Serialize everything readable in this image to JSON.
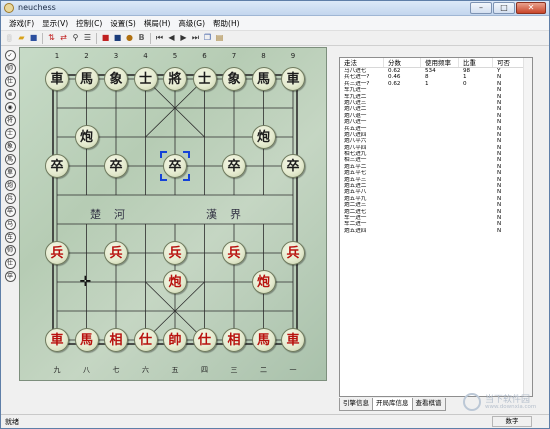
{
  "window": {
    "title": "neuchess"
  },
  "menu": [
    "游戏(F)",
    "显示(V)",
    "控制(C)",
    "设置(S)",
    "棋局(H)",
    "高级(G)",
    "帮助(H)"
  ],
  "toolbar": {
    "icons": [
      "new-icon",
      "open-icon",
      "save-icon",
      "flip-board-icon",
      "swap-icon",
      "tree-icon",
      "list-icon",
      "red-stop-icon",
      "computer-icon",
      "bold-icon",
      "first-move-icon",
      "prev-move-icon",
      "next-move-icon",
      "last-move-icon",
      "copy-icon",
      "paste-icon"
    ]
  },
  "left_tools": [
    "✓",
    "帅",
    "仕",
    "⊗",
    "◉",
    "将",
    "士",
    "象",
    "馬",
    "車",
    "炮",
    "兵",
    "卒",
    "马",
    "车",
    "帅",
    "仕",
    "卒"
  ],
  "board": {
    "top_files": [
      "1",
      "2",
      "3",
      "4",
      "5",
      "6",
      "7",
      "8",
      "9"
    ],
    "bottom_files": [
      "九",
      "八",
      "七",
      "六",
      "五",
      "四",
      "三",
      "二",
      "一"
    ],
    "river_left": "楚　河",
    "river_right": "漢　界",
    "pieces": [
      {
        "ch": "車",
        "side": "black",
        "col": 0,
        "row": 0
      },
      {
        "ch": "馬",
        "side": "black",
        "col": 1,
        "row": 0
      },
      {
        "ch": "象",
        "side": "black",
        "col": 2,
        "row": 0
      },
      {
        "ch": "士",
        "side": "black",
        "col": 3,
        "row": 0
      },
      {
        "ch": "將",
        "side": "black",
        "col": 4,
        "row": 0
      },
      {
        "ch": "士",
        "side": "black",
        "col": 5,
        "row": 0
      },
      {
        "ch": "象",
        "side": "black",
        "col": 6,
        "row": 0
      },
      {
        "ch": "馬",
        "side": "black",
        "col": 7,
        "row": 0
      },
      {
        "ch": "車",
        "side": "black",
        "col": 8,
        "row": 0
      },
      {
        "ch": "炮",
        "side": "black",
        "col": 1,
        "row": 2
      },
      {
        "ch": "炮",
        "side": "black",
        "col": 7,
        "row": 2
      },
      {
        "ch": "卒",
        "side": "black",
        "col": 0,
        "row": 3
      },
      {
        "ch": "卒",
        "side": "black",
        "col": 2,
        "row": 3
      },
      {
        "ch": "卒",
        "side": "black",
        "col": 4,
        "row": 3
      },
      {
        "ch": "卒",
        "side": "black",
        "col": 6,
        "row": 3
      },
      {
        "ch": "卒",
        "side": "black",
        "col": 8,
        "row": 3
      },
      {
        "ch": "兵",
        "side": "red",
        "col": 0,
        "row": 6
      },
      {
        "ch": "兵",
        "side": "red",
        "col": 2,
        "row": 6
      },
      {
        "ch": "兵",
        "side": "red",
        "col": 4,
        "row": 6
      },
      {
        "ch": "兵",
        "side": "red",
        "col": 6,
        "row": 6
      },
      {
        "ch": "兵",
        "side": "red",
        "col": 8,
        "row": 6
      },
      {
        "ch": "炮",
        "side": "red",
        "col": 4,
        "row": 7
      },
      {
        "ch": "炮",
        "side": "red",
        "col": 7,
        "row": 7
      },
      {
        "ch": "車",
        "side": "red",
        "col": 0,
        "row": 9
      },
      {
        "ch": "馬",
        "side": "red",
        "col": 1,
        "row": 9
      },
      {
        "ch": "相",
        "side": "red",
        "col": 2,
        "row": 9
      },
      {
        "ch": "仕",
        "side": "red",
        "col": 3,
        "row": 9
      },
      {
        "ch": "帥",
        "side": "red",
        "col": 4,
        "row": 9
      },
      {
        "ch": "仕",
        "side": "red",
        "col": 5,
        "row": 9
      },
      {
        "ch": "相",
        "side": "red",
        "col": 6,
        "row": 9
      },
      {
        "ch": "馬",
        "side": "red",
        "col": 7,
        "row": 9
      },
      {
        "ch": "車",
        "side": "red",
        "col": 8,
        "row": 9
      }
    ],
    "selected": {
      "col": 4,
      "row": 3
    },
    "cursor": {
      "col": 1,
      "row": 7
    }
  },
  "book": {
    "headers": [
      "走法",
      "分数",
      "使用频率",
      "比重",
      "可否"
    ],
    "rows": [
      [
        "马八进七",
        "0.62",
        "534",
        "98",
        "Y"
      ],
      [
        "兵七进一?",
        "0.46",
        "8",
        "1",
        "N"
      ],
      [
        "兵三进一?",
        "0.62",
        "1",
        "0",
        "N"
      ],
      [
        "车九进一",
        "",
        "",
        "",
        "N"
      ],
      [
        "车九进二",
        "",
        "",
        "",
        "N"
      ],
      [
        "炮八进三",
        "",
        "",
        "",
        "N"
      ],
      [
        "炮八进二",
        "",
        "",
        "",
        "N"
      ],
      [
        "炮八退一",
        "",
        "",
        "",
        "N"
      ],
      [
        "炮八进一",
        "",
        "",
        "",
        "N"
      ],
      [
        "兵五进一",
        "",
        "",
        "",
        "N"
      ],
      [
        "炮八进四",
        "",
        "",
        "",
        "N"
      ],
      [
        "炮八平六",
        "",
        "",
        "",
        "N"
      ],
      [
        "炮八平四",
        "",
        "",
        "",
        "N"
      ],
      [
        "相七进九",
        "",
        "",
        "",
        "N"
      ],
      [
        "相三进一",
        "",
        "",
        "",
        "N"
      ],
      [
        "炮五平二",
        "",
        "",
        "",
        "N"
      ],
      [
        "炮五平七",
        "",
        "",
        "",
        "N"
      ],
      [
        "炮五平三",
        "",
        "",
        "",
        "N"
      ],
      [
        "炮五进二",
        "",
        "",
        "",
        "N"
      ],
      [
        "炮五平八",
        "",
        "",
        "",
        "N"
      ],
      [
        "炮五平九",
        "",
        "",
        "",
        "N"
      ],
      [
        "炮二进三",
        "",
        "",
        "",
        "N"
      ],
      [
        "炮二进七",
        "",
        "",
        "",
        "N"
      ],
      [
        "车一进一",
        "",
        "",
        "",
        "N"
      ],
      [
        "车二进一",
        "",
        "",
        "",
        "N"
      ],
      [
        "炮五进四",
        "",
        "",
        "",
        "N"
      ]
    ]
  },
  "tabs": [
    "引擎信息",
    "开局库信息",
    "查看棋谱"
  ],
  "status": {
    "text": "就绪",
    "right": "数字"
  },
  "watermark": {
    "line1": "当下软件园",
    "line2": "www.downxia.com"
  }
}
